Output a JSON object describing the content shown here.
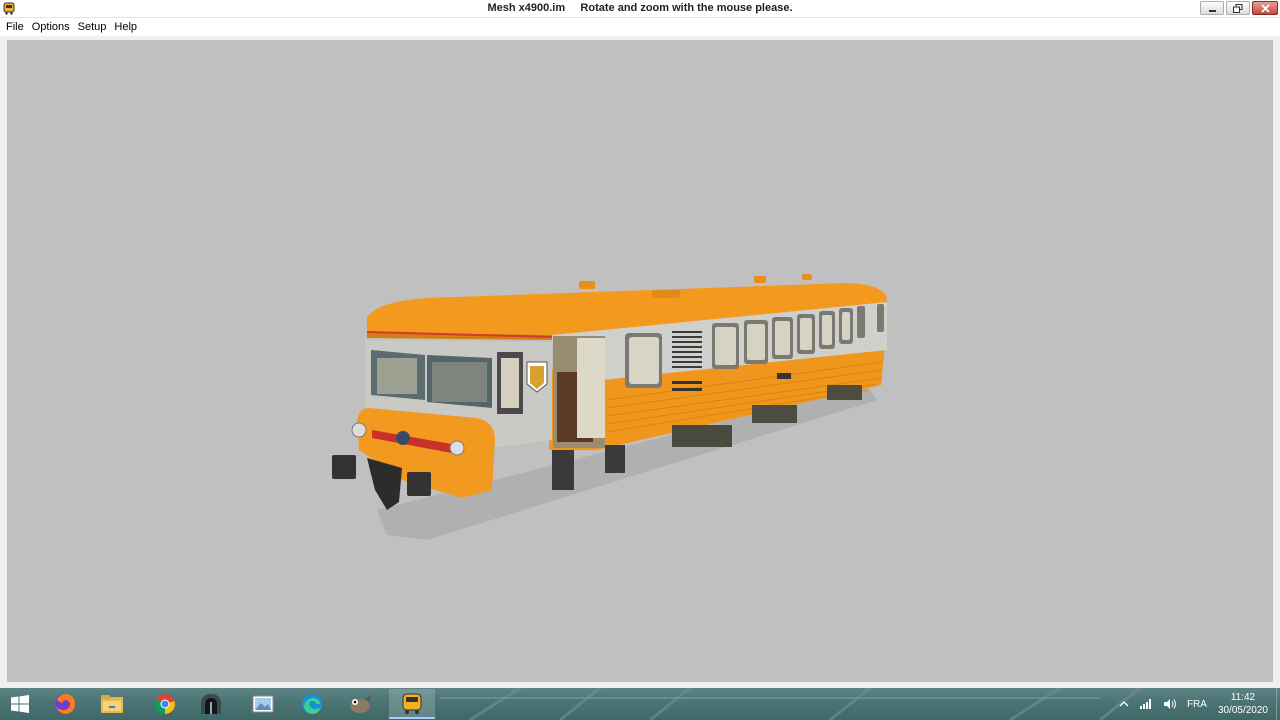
{
  "window": {
    "title": "Mesh x4900.im     Rotate and zoom with the mouse please.",
    "minimize_icon": "minimize-icon",
    "maximize_icon": "restore-icon",
    "close_icon": "close-icon"
  },
  "menu": {
    "items": [
      {
        "label": "File"
      },
      {
        "label": "Options"
      },
      {
        "label": "Setup"
      },
      {
        "label": "Help"
      }
    ]
  },
  "viewport": {
    "background": "#c0c0c0",
    "model": "x4900 railcar (orange/silver)"
  },
  "taskbar": {
    "start_icon": "windows-start-icon",
    "apps": [
      {
        "name": "firefox-icon"
      },
      {
        "name": "file-explorer-icon"
      },
      {
        "name": "chrome-icon"
      },
      {
        "name": "tunnel-app-icon"
      },
      {
        "name": "photo-viewer-icon"
      },
      {
        "name": "edge-icon"
      },
      {
        "name": "gimp-icon"
      },
      {
        "name": "train-app-icon"
      }
    ],
    "tray": {
      "chevron": "^",
      "language": "FRA",
      "time": "11:42",
      "date": "30/05/2020"
    }
  },
  "colors": {
    "train_orange": "#f39a1e",
    "train_silver": "#c8c8c4",
    "viewport_gray": "#c0c0c0",
    "taskbar_teal": "#4c7575"
  }
}
